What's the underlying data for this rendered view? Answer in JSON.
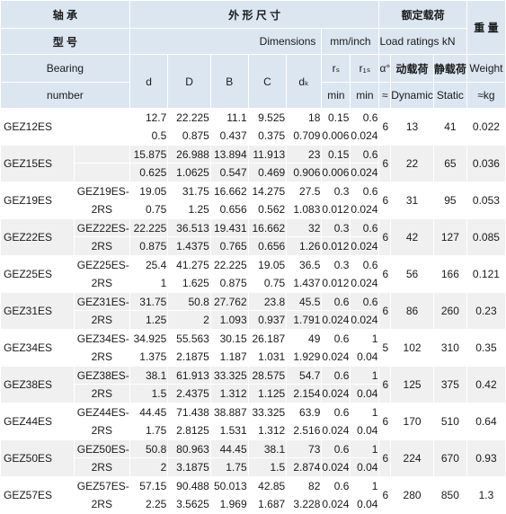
{
  "header": {
    "model_cn_1": "轴 承",
    "model_cn_2": "型 号",
    "model_en_1": "Bearing",
    "model_en_2": "number",
    "dims_cn": "外 形 尺 寸",
    "dims_en": "Dimensions",
    "dims_unit": "mm/inch",
    "load_cn": "额定载荷",
    "load_en": "Load ratings  kN",
    "weight_cn": "重 量",
    "weight_en": "Weight",
    "weight_unit": "≈kg",
    "col_d": "d",
    "col_D": "D",
    "col_B": "B",
    "col_C": "C",
    "col_dk": "dₖ",
    "col_rs": "rₛ",
    "col_r1s": "r₁ₛ",
    "col_rs_sub": "min",
    "col_r1s_sub": "min",
    "col_alpha": "α°",
    "col_alpha_sub": "≈",
    "dynamic_cn": "动载荷",
    "dynamic_en": "Dynamic",
    "static_cn": "静载荷",
    "static_en": "Static"
  },
  "rows": [
    {
      "model": "GEZ12ES",
      "alt": [
        "",
        ""
      ],
      "d": [
        "12.7",
        "0.5"
      ],
      "D": [
        "22.225",
        "0.875"
      ],
      "B": [
        "11.1",
        "0.437"
      ],
      "C": [
        "9.525",
        "0.375"
      ],
      "dk": [
        "18",
        "0.709"
      ],
      "rs": [
        "0.15",
        "0.006"
      ],
      "r1s": [
        "0.6",
        "0.024"
      ],
      "alpha": "6",
      "dynamic": "13",
      "static": "41",
      "weight": "0.022"
    },
    {
      "model": "GEZ15ES",
      "alt": [
        "",
        ""
      ],
      "d": [
        "15.875",
        "0.625"
      ],
      "D": [
        "26.988",
        "1.0625"
      ],
      "B": [
        "13.894",
        "0.547"
      ],
      "C": [
        "11.913",
        "0.469"
      ],
      "dk": [
        "23",
        "0.906"
      ],
      "rs": [
        "0.15",
        "0.006"
      ],
      "r1s": [
        "0.6",
        "0.024"
      ],
      "alpha": "6",
      "dynamic": "22",
      "static": "65",
      "weight": "0.036"
    },
    {
      "model": "GEZ19ES",
      "alt": [
        "GEZ19ES-",
        "2RS"
      ],
      "d": [
        "19.05",
        "0.75"
      ],
      "D": [
        "31.75",
        "1.25"
      ],
      "B": [
        "16.662",
        "0.656"
      ],
      "C": [
        "14.275",
        "0.562"
      ],
      "dk": [
        "27.5",
        "1.083"
      ],
      "rs": [
        "0.3",
        "0.012"
      ],
      "r1s": [
        "0.6",
        "0.024"
      ],
      "alpha": "6",
      "dynamic": "31",
      "static": "95",
      "weight": "0.053"
    },
    {
      "model": "GEZ22ES",
      "alt": [
        "GEZ22ES-",
        "2RS"
      ],
      "d": [
        "22.225",
        "0.875"
      ],
      "D": [
        "36.513",
        "1.4375"
      ],
      "B": [
        "19.431",
        "0.765"
      ],
      "C": [
        "16.662",
        "0.656"
      ],
      "dk": [
        "32",
        "1.26"
      ],
      "rs": [
        "0.3",
        "0.012"
      ],
      "r1s": [
        "0.6",
        "0.024"
      ],
      "alpha": "6",
      "dynamic": "42",
      "static": "127",
      "weight": "0.085"
    },
    {
      "model": "GEZ25ES",
      "alt": [
        "GEZ25ES-",
        "2RS"
      ],
      "d": [
        "25.4",
        "1"
      ],
      "D": [
        "41.275",
        "1.625"
      ],
      "B": [
        "22.225",
        "0.875"
      ],
      "C": [
        "19.05",
        "0.75"
      ],
      "dk": [
        "36.5",
        "1.437"
      ],
      "rs": [
        "0.3",
        "0.012"
      ],
      "r1s": [
        "0.6",
        "0.024"
      ],
      "alpha": "6",
      "dynamic": "56",
      "static": "166",
      "weight": "0.121"
    },
    {
      "model": "GEZ31ES",
      "alt": [
        "GEZ31ES-",
        "2RS"
      ],
      "d": [
        "31.75",
        "1.25"
      ],
      "D": [
        "50.8",
        "2"
      ],
      "B": [
        "27.762",
        "1.093"
      ],
      "C": [
        "23.8",
        "0.937"
      ],
      "dk": [
        "45.5",
        "1.791"
      ],
      "rs": [
        "0.6",
        "0.024"
      ],
      "r1s": [
        "0.6",
        "0.024"
      ],
      "alpha": "6",
      "dynamic": "86",
      "static": "260",
      "weight": "0.23"
    },
    {
      "model": "GEZ34ES",
      "alt": [
        "GEZ34ES-",
        "2RS"
      ],
      "d": [
        "34.925",
        "1.375"
      ],
      "D": [
        "55.563",
        "2.1875"
      ],
      "B": [
        "30.15",
        "1.187"
      ],
      "C": [
        "26.187",
        "1.031"
      ],
      "dk": [
        "49",
        "1.929"
      ],
      "rs": [
        "0.6",
        "0.024"
      ],
      "r1s": [
        "1",
        "0.04"
      ],
      "alpha": "5",
      "dynamic": "102",
      "static": "310",
      "weight": "0.35"
    },
    {
      "model": "GEZ38ES",
      "alt": [
        "GEZ38ES-",
        "2RS"
      ],
      "d": [
        "38.1",
        "1.5"
      ],
      "D": [
        "61.913",
        "2.4375"
      ],
      "B": [
        "33.325",
        "1.312"
      ],
      "C": [
        "28.575",
        "1.125"
      ],
      "dk": [
        "54.7",
        "2.154"
      ],
      "rs": [
        "0.6",
        "0.024"
      ],
      "r1s": [
        "1",
        "0.04"
      ],
      "alpha": "6",
      "dynamic": "125",
      "static": "375",
      "weight": "0.42"
    },
    {
      "model": "GEZ44ES",
      "alt": [
        "GEZ44ES-",
        "2RS"
      ],
      "d": [
        "44.45",
        "1.75"
      ],
      "D": [
        "71.438",
        "2.8125"
      ],
      "B": [
        "38.887",
        "1.531"
      ],
      "C": [
        "33.325",
        "1.312"
      ],
      "dk": [
        "63.9",
        "2.516"
      ],
      "rs": [
        "0.6",
        "0.024"
      ],
      "r1s": [
        "1",
        "0.04"
      ],
      "alpha": "6",
      "dynamic": "170",
      "static": "510",
      "weight": "0.64"
    },
    {
      "model": "GEZ50ES",
      "alt": [
        "GEZ50ES-",
        "2RS"
      ],
      "d": [
        "50.8",
        "2"
      ],
      "D": [
        "80.963",
        "3.1875"
      ],
      "B": [
        "44.45",
        "1.75"
      ],
      "C": [
        "38.1",
        "1.5"
      ],
      "dk": [
        "73",
        "2.874"
      ],
      "rs": [
        "0.6",
        "0.024"
      ],
      "r1s": [
        "1",
        "0.04"
      ],
      "alpha": "6",
      "dynamic": "224",
      "static": "670",
      "weight": "0.93"
    },
    {
      "model": "GEZ57ES",
      "alt": [
        "GEZ57ES-",
        "2RS"
      ],
      "d": [
        "57.15",
        "2.25"
      ],
      "D": [
        "90.488",
        "3.5625"
      ],
      "B": [
        "50.013",
        "1.969"
      ],
      "C": [
        "42.85",
        "1.687"
      ],
      "dk": [
        "82",
        "3.228"
      ],
      "rs": [
        "0.6",
        "0.024"
      ],
      "r1s": [
        "1",
        "0.04"
      ],
      "alpha": "6",
      "dynamic": "280",
      "static": "850",
      "weight": "1.3"
    }
  ]
}
